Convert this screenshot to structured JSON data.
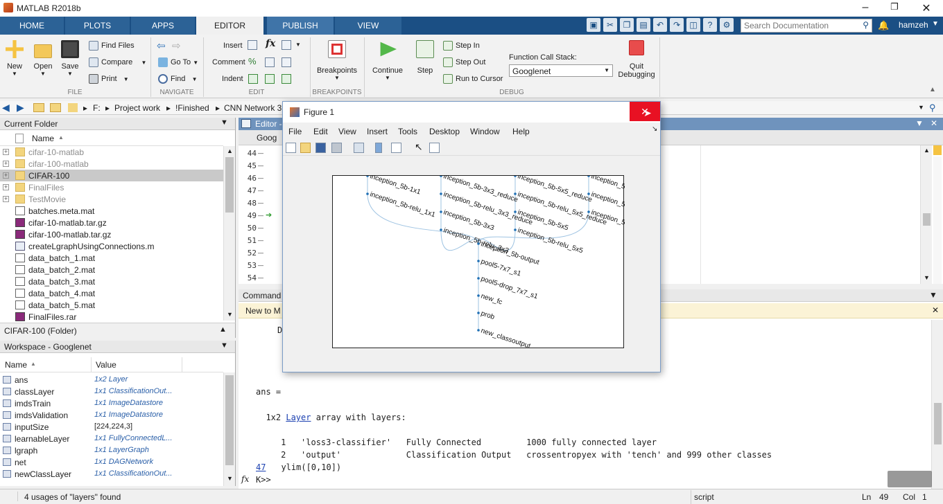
{
  "window": {
    "title": "MATLAB R2018b",
    "user": "hamzeh"
  },
  "tabs": [
    {
      "label": "HOME"
    },
    {
      "label": "PLOTS"
    },
    {
      "label": "APPS"
    },
    {
      "label": "EDITOR"
    },
    {
      "label": "PUBLISH"
    },
    {
      "label": "VIEW"
    }
  ],
  "search": {
    "placeholder": "Search Documentation"
  },
  "ribbon": {
    "file": {
      "group": "FILE",
      "new": "New",
      "open": "Open",
      "save": "Save",
      "find_files": "Find Files",
      "compare": "Compare",
      "print": "Print"
    },
    "navigate": {
      "group": "NAVIGATE",
      "goto": "Go To",
      "find": "Find"
    },
    "edit": {
      "group": "EDIT",
      "insert": "Insert",
      "comment": "Comment",
      "indent": "Indent",
      "fx": "fx"
    },
    "breakpoints": {
      "group": "BREAKPOINTS",
      "label": "Breakpoints"
    },
    "debug": {
      "group": "DEBUG",
      "continue": "Continue",
      "step": "Step",
      "step_in": "Step In",
      "step_out": "Step Out",
      "run_to_cursor": "Run to Cursor",
      "stack_label": "Function Call Stack:",
      "stack_value": "Googlenet",
      "quit": "Quit",
      "quit2": "Debugging"
    }
  },
  "address": {
    "drive": "F:",
    "p1": "Project work",
    "p2": "!Finished",
    "p3": "CNN Network 3"
  },
  "current_folder": {
    "title": "Current Folder",
    "col_name": "Name",
    "items": [
      {
        "name": "cifar-10-matlab",
        "type": "folder",
        "dim": true
      },
      {
        "name": "cifar-100-matlab",
        "type": "folder",
        "dim": true
      },
      {
        "name": "CIFAR-100",
        "type": "folder",
        "selected": true
      },
      {
        "name": "FinalFiles",
        "type": "folder",
        "dim": true
      },
      {
        "name": "TestMovie",
        "type": "folder",
        "dim": true
      },
      {
        "name": "batches.meta.mat",
        "type": "file"
      },
      {
        "name": "cifar-10-matlab.tar.gz",
        "type": "rar"
      },
      {
        "name": "cifar-100-matlab.tar.gz",
        "type": "rar"
      },
      {
        "name": "createLgraphUsingConnections.m",
        "type": "m"
      },
      {
        "name": "data_batch_1.mat",
        "type": "file"
      },
      {
        "name": "data_batch_2.mat",
        "type": "file"
      },
      {
        "name": "data_batch_3.mat",
        "type": "file"
      },
      {
        "name": "data_batch_4.mat",
        "type": "file"
      },
      {
        "name": "data_batch_5.mat",
        "type": "file"
      },
      {
        "name": "FinalFiles.rar",
        "type": "rar"
      }
    ],
    "details": "CIFAR-100  (Folder)"
  },
  "workspace": {
    "title": "Workspace - Googlenet",
    "col_name": "Name",
    "col_value": "Value",
    "vars": [
      {
        "name": "ans",
        "value": "1x2 Layer"
      },
      {
        "name": "classLayer",
        "value": "1x1 ClassificationOut..."
      },
      {
        "name": "imdsTrain",
        "value": "1x1 ImageDatastore"
      },
      {
        "name": "imdsValidation",
        "value": "1x1 ImageDatastore"
      },
      {
        "name": "inputSize",
        "value": "[224,224,3]",
        "plain": true
      },
      {
        "name": "learnableLayer",
        "value": "1x1 FullyConnectedL..."
      },
      {
        "name": "lgraph",
        "value": "1x1 LayerGraph"
      },
      {
        "name": "net",
        "value": "1x1 DAGNetwork"
      },
      {
        "name": "newClassLayer",
        "value": "1x1 ClassificationOut..."
      }
    ]
  },
  "editor": {
    "title": "Editor -",
    "tab": "Goog",
    "lines": [
      "44",
      "45",
      "46",
      "47",
      "48",
      "49",
      "50",
      "51",
      "52",
      "53",
      "54"
    ]
  },
  "command": {
    "title": "Command",
    "notice": "New to M",
    "frag1": "D",
    "ans": "ans =",
    "array_prefix": "  1x2 ",
    "array_link": "Layer",
    "array_suffix": " array with layers:",
    "rows": [
      "     1   'loss3-classifier'   Fully Connected         1000 fully connected layer",
      "     2   'output'             Classification Output   crossentropyex with 'tench' and 999 other classes"
    ],
    "prev_num": "47",
    "prev_cmd": "  ylim([0,10])",
    "prompt": "K>> "
  },
  "status": {
    "msg": "4 usages of \"layers\" found",
    "mode": "script",
    "ln_label": "Ln",
    "ln": "49",
    "col_label": "Col",
    "col": "1"
  },
  "figure": {
    "title": "Figure 1",
    "menu": [
      "File",
      "Edit",
      "View",
      "Insert",
      "Tools",
      "Desktop",
      "Window",
      "Help"
    ],
    "nodes": [
      "inception_5b-1x1",
      "inception_5b-relu_1x1",
      "inception_5b-3x3_reduce",
      "inception_5b-relu_3x3_reduce",
      "inception_5b-3x3",
      "inception_5b-relu_3x3",
      "inception_5b-5x5_reduce",
      "inception_5b-relu_5x5_reduce",
      "inception_5b-5x5",
      "inception_5b-relu_5x5",
      "inception_5b-pool",
      "inception_5b-pool_proj",
      "inception_5b-relu_pool_proj",
      "inception_5b-output",
      "pool5-7x7_s1",
      "pool5-drop_7x7_s1",
      "new_fc",
      "prob",
      "new_classoutput"
    ]
  }
}
